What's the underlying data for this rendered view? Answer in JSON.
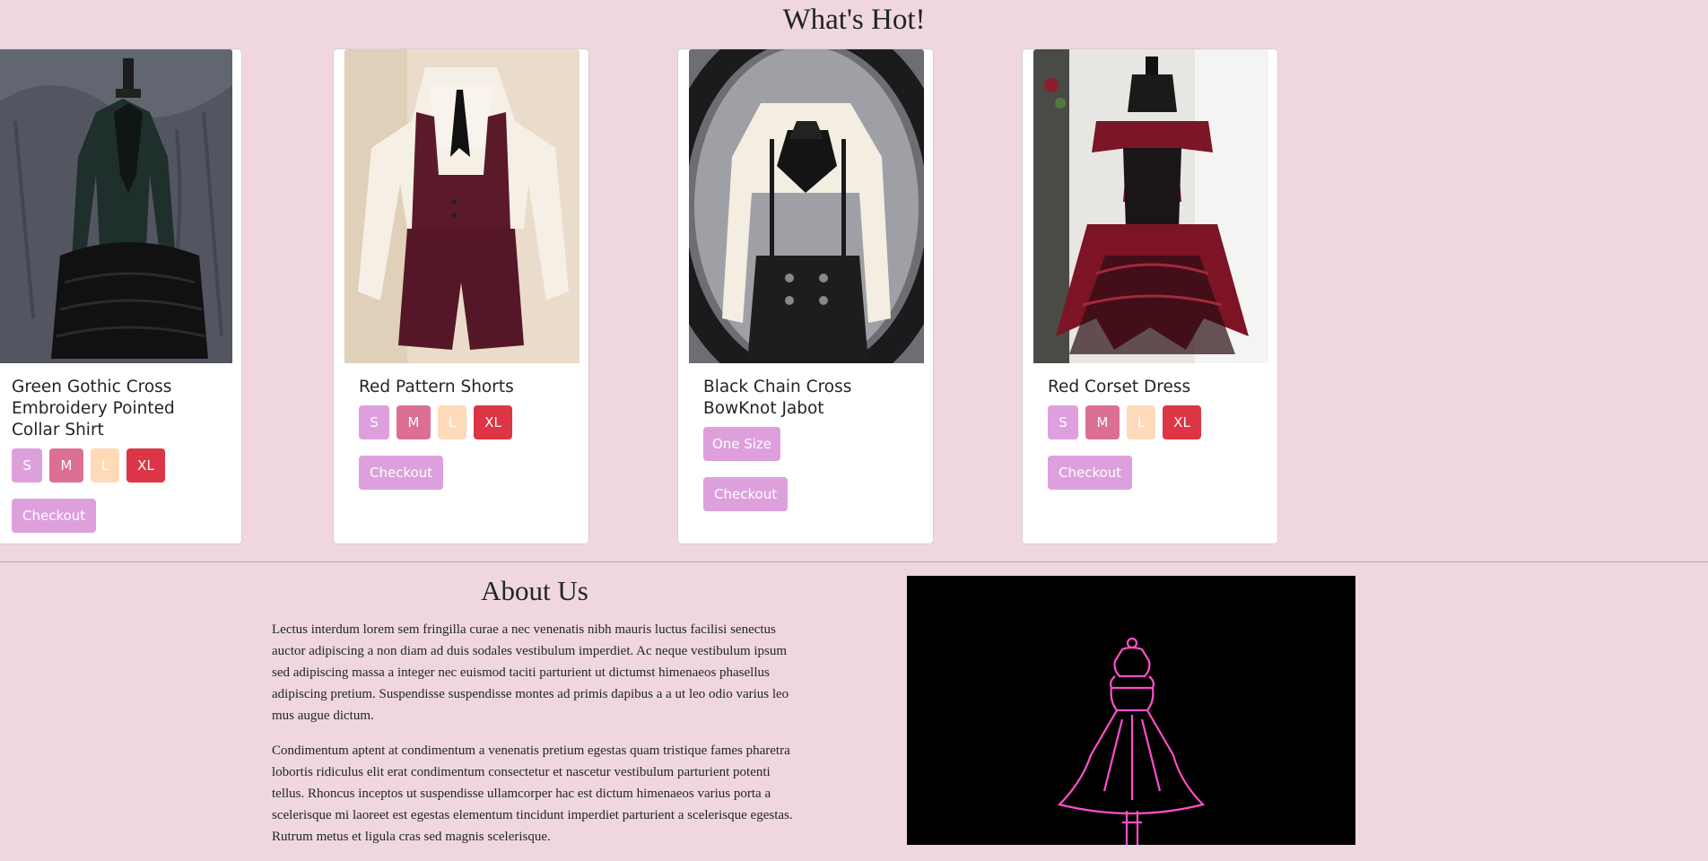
{
  "hot_section": {
    "title": "What's Hot!",
    "products": [
      {
        "name": "Green Gothic Cross Embroidery Pointed Collar Shirt",
        "image_desc_icon": "green-gothic-shirt-image",
        "sizes": [
          "S",
          "M",
          "L",
          "XL"
        ],
        "checkout_label": "Checkout"
      },
      {
        "name": "Red Pattern Shorts",
        "image_desc_icon": "red-shorts-image",
        "sizes": [
          "S",
          "M",
          "L",
          "XL"
        ],
        "checkout_label": "Checkout"
      },
      {
        "name": "Black Chain Cross BowKnot Jabot",
        "image_desc_icon": "black-jabot-image",
        "sizes": [
          "One Size"
        ],
        "checkout_label": "Checkout"
      },
      {
        "name": "Red Corset Dress",
        "image_desc_icon": "red-corset-dress-image",
        "sizes": [
          "S",
          "M",
          "L",
          "XL"
        ],
        "checkout_label": "Checkout"
      }
    ]
  },
  "about": {
    "title": "About Us",
    "paragraphs": [
      "Lectus interdum lorem sem fringilla curae a nec venenatis nibh mauris luctus facilisi senectus auctor adipiscing a non diam ad duis sodales vestibulum imperdiet. Ac neque vestibulum ipsum sed adipiscing massa a integer nec euismod taciti parturient ut dictumst himenaeos phasellus adipiscing pretium. Suspendisse suspendisse montes ad primis dapibus a a ut leo odio varius leo mus augue dictum.",
      "Condimentum aptent at condimentum a venenatis pretium egestas quam tristique fames pharetra lobortis ridiculus elit erat condimentum consectetur et nascetur vestibulum parturient potenti tellus. Rhoncus inceptos ut suspendisse ullamcorper hac est dictum himenaeos varius porta a scelerisque mi laoreet est egestas elementum tincidunt imperdiet parturient a scelerisque egestas. Rutrum metus et ligula cras sed magnis scelerisque."
    ],
    "image_icon": "neon-dress-image"
  },
  "colors": {
    "background": "#f0d7de",
    "size_s": "#dda0dd",
    "size_m": "#db7093",
    "size_l": "#ffdab9",
    "size_xl": "#dc3545",
    "checkout": "#dda0dd",
    "neon_pink": "#ff4fc8"
  }
}
